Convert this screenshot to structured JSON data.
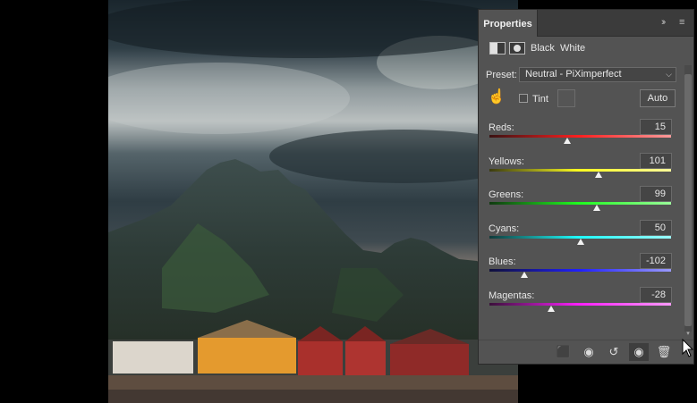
{
  "panel": {
    "tab_label": "Properties",
    "collapse_icon": "double-chevron-right",
    "menu_icon": "hamburger-menu",
    "adjustment_title": "Black  White",
    "preset_label": "Preset:",
    "preset_value": "Neutral - PiXimperfect",
    "tint_label": "Tint",
    "tint_checked": false,
    "auto_label": "Auto",
    "sliders": [
      {
        "label": "Reds:",
        "value": "15",
        "position": 0.43,
        "gradient": [
          "#3a1212",
          "#ff2020",
          "#ff9a9a"
        ]
      },
      {
        "label": "Yellows:",
        "value": "101",
        "position": 0.6,
        "gradient": [
          "#3a3a10",
          "#ffff20",
          "#ffff9a"
        ]
      },
      {
        "label": "Greens:",
        "value": "99",
        "position": 0.59,
        "gradient": [
          "#103a10",
          "#20ff20",
          "#9aff9a"
        ]
      },
      {
        "label": "Cyans:",
        "value": "50",
        "position": 0.5,
        "gradient": [
          "#103a3a",
          "#20ffff",
          "#9affff"
        ]
      },
      {
        "label": "Blues:",
        "value": "-102",
        "position": 0.19,
        "gradient": [
          "#10103a",
          "#2020ff",
          "#9a9aff"
        ]
      },
      {
        "label": "Magentas:",
        "value": "-28",
        "position": 0.34,
        "gradient": [
          "#3a103a",
          "#ff20ff",
          "#ff9aff"
        ]
      }
    ],
    "toolbar_icons": [
      "clip-to-layer-icon",
      "view-previous-state-icon",
      "reset-icon",
      "visibility-icon",
      "trash-icon"
    ]
  }
}
